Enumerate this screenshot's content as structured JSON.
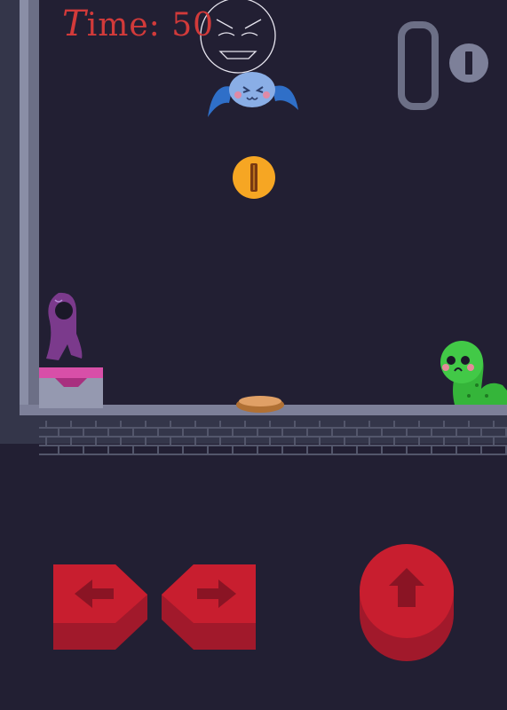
{
  "hud": {
    "timer_prefix": "T",
    "timer_rest": "ime: ",
    "time_value": "50",
    "coin_count": "0"
  },
  "controls": {
    "left_icon": "arrow-left-icon",
    "right_icon": "arrow-right-icon",
    "jump_icon": "arrow-up-icon"
  },
  "entities": {
    "player": "purple-hooded-figure",
    "enemy_ghost": "outline-angry-ghost",
    "enemy_bat": "blue-bat",
    "enemy_worm": "green-worm",
    "pickup": "gold-coin",
    "pressure_plate": "bread-pad"
  },
  "colors": {
    "background": "#221f33",
    "wall": "#6c6f86",
    "control_red": "#c81e2f",
    "coin_gold": "#f6a623",
    "timer_text": "#d23a3a"
  }
}
